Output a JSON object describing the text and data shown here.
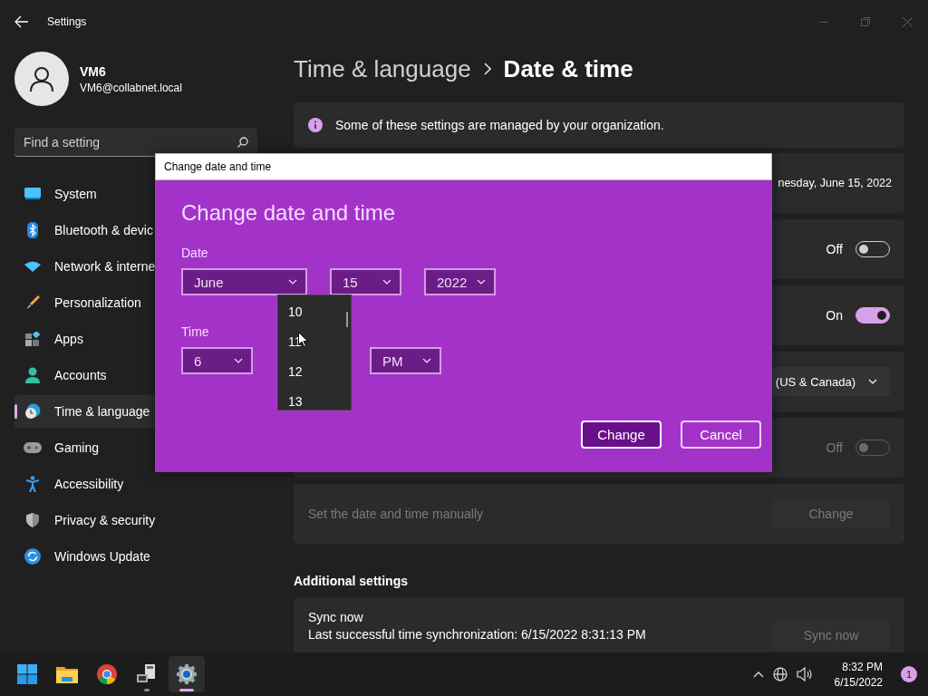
{
  "window": {
    "title": "Settings"
  },
  "user": {
    "name": "VM6",
    "email": "VM6@collabnet.local"
  },
  "search": {
    "placeholder": "Find a setting"
  },
  "nav": [
    {
      "label": "System",
      "selected": false
    },
    {
      "label": "Bluetooth & devic",
      "selected": false
    },
    {
      "label": "Network & interne",
      "selected": false
    },
    {
      "label": "Personalization",
      "selected": false
    },
    {
      "label": "Apps",
      "selected": false
    },
    {
      "label": "Accounts",
      "selected": false
    },
    {
      "label": "Time & language",
      "selected": true
    },
    {
      "label": "Gaming",
      "selected": false
    },
    {
      "label": "Accessibility",
      "selected": false
    },
    {
      "label": "Privacy & security",
      "selected": false
    },
    {
      "label": "Windows Update",
      "selected": false
    }
  ],
  "breadcrumb": {
    "parent": "Time & language",
    "current": "Date & time"
  },
  "rows": [
    {
      "kind": "info",
      "text": "Some of these settings are managed by your organization."
    },
    {
      "kind": "value",
      "value": "nesday, June 15, 2022"
    },
    {
      "kind": "toggle",
      "state": "Off",
      "on": false,
      "disabled": false
    },
    {
      "kind": "toggle",
      "state": "On",
      "on": true,
      "disabled": false
    },
    {
      "kind": "select",
      "value": "(US & Canada)"
    },
    {
      "kind": "toggle",
      "state": "Off",
      "on": false,
      "disabled": true
    },
    {
      "kind": "button",
      "label": "Set the date and time manually",
      "button": "Change",
      "disabled": true
    }
  ],
  "additional": {
    "heading": "Additional settings",
    "title": "Sync now",
    "detail": "Last successful time synchronization: 6/15/2022 8:31:13 PM",
    "button": "Sync now",
    "disabled": true
  },
  "dialog": {
    "title": "Change date and time",
    "heading": "Change date and time",
    "date_label": "Date",
    "date": [
      "June",
      "15",
      "2022"
    ],
    "time_label": "Time",
    "time": [
      "6",
      "PM"
    ],
    "list": [
      "10",
      "11",
      "12",
      "13"
    ],
    "buttons": [
      {
        "label": "Change",
        "primary": true
      },
      {
        "label": "Cancel",
        "primary": false
      }
    ]
  },
  "taskbar": {
    "apps": [
      {
        "selected": false,
        "running": false
      },
      {
        "selected": false,
        "running": false
      },
      {
        "selected": false,
        "running": false
      },
      {
        "selected": false,
        "running": true
      },
      {
        "selected": true,
        "running": true
      }
    ],
    "time": "8:32 PM",
    "date": "6/15/2022",
    "badge": "1"
  }
}
